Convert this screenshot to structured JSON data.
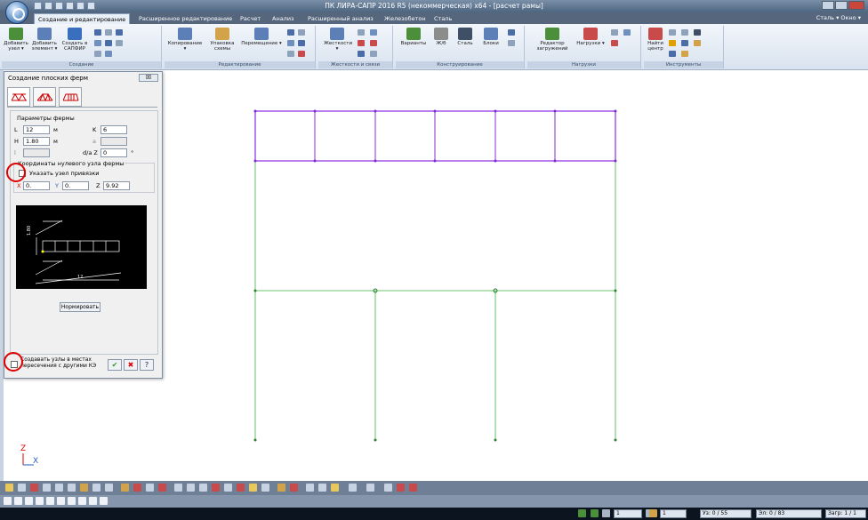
{
  "window": {
    "title": "ПК ЛИРА-САПР 2016 R5 (некоммерческая) x64 - [расчет рамы]"
  },
  "ribbon_tabs": [
    {
      "label": "Создание и редактирование",
      "active": true
    },
    {
      "label": "Расширенное редактирование"
    },
    {
      "label": "Расчет"
    },
    {
      "label": "Анализ"
    },
    {
      "label": "Расширенный анализ"
    },
    {
      "label": "Железобетон"
    },
    {
      "label": "Сталь"
    }
  ],
  "ribbon_right": "Сталь ▾ Окно ▾",
  "ribbon": {
    "groups": [
      {
        "label": "Создание",
        "buttons": [
          "Добавить узел ▾",
          "Добавить элемент ▾",
          "Создать в САПФИР"
        ]
      },
      {
        "label": "Редактирование",
        "buttons": [
          "Копирование ▾",
          "Упаковка схемы",
          "Перемещение ▾"
        ]
      },
      {
        "label": "Жесткости и связи",
        "buttons": [
          "Жесткости ▾"
        ]
      },
      {
        "label": "Конструирование",
        "buttons": [
          "Варианты",
          "Ж/б",
          "Сталь",
          "Блоки"
        ]
      },
      {
        "label": "Нагрузки",
        "buttons": [
          "Редактор загружений",
          "Нагрузки ▾"
        ]
      },
      {
        "label": "Инструменты",
        "buttons": [
          "Найти центр"
        ]
      }
    ]
  },
  "dialog": {
    "title": "Создание плоских ферм",
    "close_label": "☒",
    "params_label": "Параметры фермы",
    "L_label": "L",
    "L_value": "12",
    "L_unit": "м",
    "H_label": "H",
    "H_value": "1.80",
    "H_unit": "м",
    "I_label": "l",
    "K_label": "K",
    "K_value": "6",
    "a_label": "a",
    "dz_label": "d/a Z",
    "dz_value": "0",
    "dz_unit": "°",
    "coords_label": "Координаты нулевого узла фермы",
    "show_node_label": "Указать узел привязки",
    "X_label": "X",
    "X_value": "0.",
    "Y_label": "Y",
    "Y_value": "0.",
    "Z_label": "Z",
    "Z_value": "9.92",
    "normalize_label": "Нормировать",
    "merge_label": "Создавать узлы в местах пересечения с другими КЭ",
    "preview_L_label": "12",
    "preview_H_label": "1.80"
  },
  "axes": {
    "z": "Z",
    "x": "X"
  },
  "statusbar": {
    "cell1_value": "1",
    "cell2_value": "1",
    "nodes": "Уз: 0 / 55",
    "elements": "Эл: 0 / 83",
    "loads": "Загр: 1 / 1"
  },
  "colors": {
    "truss": "#8a2be2",
    "frame": "#3cb043",
    "node": "#2e7d32",
    "highlight": "#e00000"
  }
}
